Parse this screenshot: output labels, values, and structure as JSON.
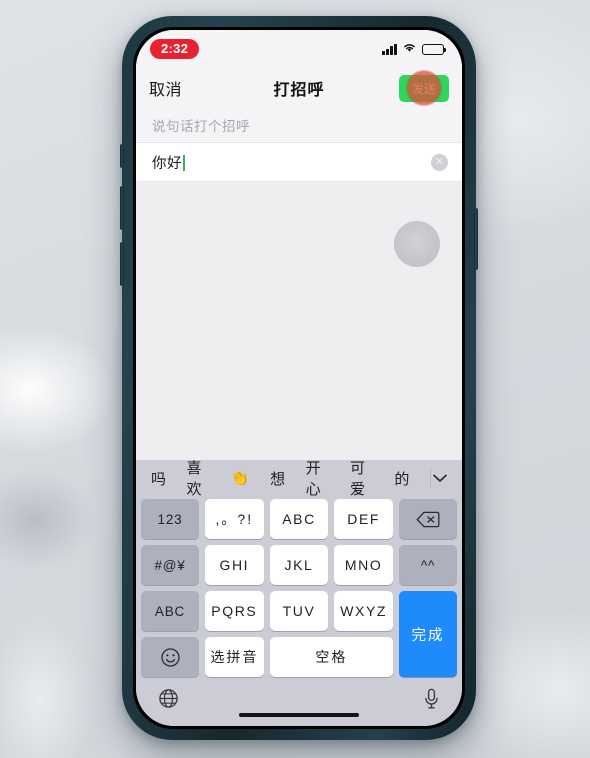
{
  "status_bar": {
    "time": "2:32",
    "time_badge_color": "#e8222e",
    "signal_icon": "cellular-bars-icon",
    "wifi_icon": "wifi-icon",
    "battery_icon": "battery-icon"
  },
  "nav_header": {
    "cancel_label": "取消",
    "title": "打招呼",
    "send_label": "发送",
    "send_button_color": "#2fd65c",
    "tap_indicator_color": "#de4837"
  },
  "form": {
    "hint_text": "说句话打个招呼",
    "input_value": "你好",
    "input_placeholder": "说句话打个招呼",
    "clear_glyph": "✕"
  },
  "keyboard": {
    "suggestions": [
      "吗",
      "喜欢",
      "👏",
      "想",
      "开心",
      "可爱",
      "的"
    ],
    "expand_icon": "chevron-down-icon",
    "rows": [
      [
        {
          "label": "123",
          "type": "mod",
          "name": "key-123"
        },
        {
          "label": ",。?!",
          "type": "cjk",
          "name": "key-punctuation"
        },
        {
          "label": "ABC",
          "type": "char",
          "name": "key-abc-2"
        },
        {
          "label": "DEF",
          "type": "char",
          "name": "key-def-3"
        },
        {
          "label": "",
          "type": "mod",
          "name": "key-backspace",
          "icon": "backspace-icon"
        }
      ],
      [
        {
          "label": "#@¥",
          "type": "mod",
          "name": "key-symbols"
        },
        {
          "label": "GHI",
          "type": "char",
          "name": "key-ghi-4"
        },
        {
          "label": "JKL",
          "type": "char",
          "name": "key-jkl-5"
        },
        {
          "label": "MNO",
          "type": "char",
          "name": "key-mno-6"
        },
        {
          "label": "^^",
          "type": "mod",
          "name": "key-kaomoji"
        }
      ],
      [
        {
          "label": "ABC",
          "type": "mod",
          "name": "key-abc-layout"
        },
        {
          "label": "PQRS",
          "type": "char",
          "name": "key-pqrs-7"
        },
        {
          "label": "TUV",
          "type": "char",
          "name": "key-tuv-8"
        },
        {
          "label": "WXYZ",
          "type": "char",
          "name": "key-wxyz-9"
        },
        {
          "label": "完成",
          "type": "done",
          "name": "key-done"
        }
      ],
      [
        {
          "label": "",
          "type": "mod",
          "name": "key-emoji",
          "icon": "smiley-icon"
        },
        {
          "label": "选拼音",
          "type": "cjk",
          "name": "key-select-pinyin"
        },
        {
          "label": "空格",
          "type": "space",
          "name": "key-space"
        }
      ]
    ],
    "done_key_color": "#1e8afb",
    "bottom_bar": {
      "globe_icon": "globe-icon",
      "mic_icon": "microphone-icon"
    }
  }
}
